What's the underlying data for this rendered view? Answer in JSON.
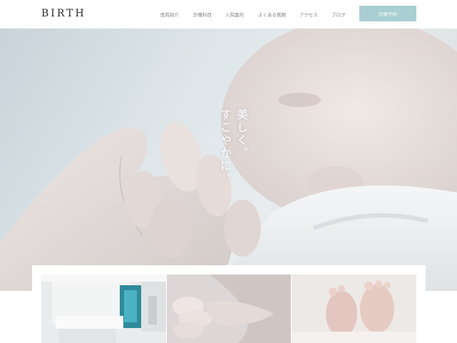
{
  "brand": {
    "logo_text": "BIRTH"
  },
  "nav": {
    "items": [
      {
        "label": "医院紹介"
      },
      {
        "label": "診療科目"
      },
      {
        "label": "入院案内"
      },
      {
        "label": "よくある質問"
      },
      {
        "label": "アクセス"
      },
      {
        "label": "ブログ"
      }
    ],
    "cta_label": "診療予約"
  },
  "hero": {
    "tagline_line1": "美しく。",
    "tagline_line2": "すこやかに。",
    "image_icon": "baby-hand-photo"
  },
  "gallery": {
    "images": [
      {
        "icon": "clinic-interior-photo"
      },
      {
        "icon": "baby-hand-photo"
      },
      {
        "icon": "baby-feet-photo"
      }
    ]
  },
  "colors": {
    "accent": "#a9cfd2",
    "text": "#2b2b2b",
    "nav_text": "#7d7d7d"
  }
}
